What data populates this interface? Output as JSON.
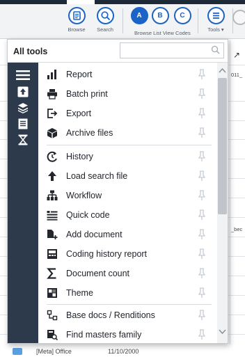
{
  "ribbon": {
    "buttons": [
      {
        "label": "Browse",
        "icon": "browse-icon"
      },
      {
        "label": "Search",
        "icon": "search-icon"
      },
      {
        "label": "",
        "icon": "list-view-a-icon",
        "glyph": "A"
      },
      {
        "label": "",
        "icon": "list-view-b-icon",
        "glyph": "B"
      },
      {
        "label": "",
        "icon": "list-view-c-icon",
        "glyph": "C"
      },
      {
        "label": "Tools ▾",
        "icon": "tools-icon"
      }
    ],
    "group_label": "Browse List View Codes",
    "accent": "#1b63c6"
  },
  "background": {
    "cell_text_1": "011_",
    "cell_text_2": "_bec",
    "meta_text": "[Meta] Office",
    "date_text": "11/10/2000"
  },
  "popup": {
    "title": "All tools",
    "search_placeholder": "",
    "rail_icons": [
      "hamburger-menu-icon",
      "upload-icon",
      "layers-icon",
      "document-icon",
      "hourglass-icon"
    ],
    "groups": [
      [
        {
          "label": "Report",
          "icon": "report-icon"
        },
        {
          "label": "Batch print",
          "icon": "print-icon"
        },
        {
          "label": "Export",
          "icon": "export-icon"
        },
        {
          "label": "Archive files",
          "icon": "archive-icon"
        }
      ],
      [
        {
          "label": "History",
          "icon": "history-icon"
        },
        {
          "label": "Load search file",
          "icon": "load-icon"
        },
        {
          "label": "Workflow",
          "icon": "workflow-icon"
        },
        {
          "label": "Quick code",
          "icon": "quick-code-icon"
        },
        {
          "label": "Add document",
          "icon": "add-document-icon"
        },
        {
          "label": "Coding history report",
          "icon": "coding-history-icon"
        },
        {
          "label": "Document count",
          "icon": "sigma-icon"
        },
        {
          "label": "Theme",
          "icon": "theme-icon"
        }
      ],
      [
        {
          "label": "Base docs / Renditions",
          "icon": "base-docs-icon"
        },
        {
          "label": "Find masters family",
          "icon": "find-masters-icon"
        }
      ]
    ],
    "rail_color": "#2d3a4b",
    "pin_color": "#c5cbd4"
  }
}
